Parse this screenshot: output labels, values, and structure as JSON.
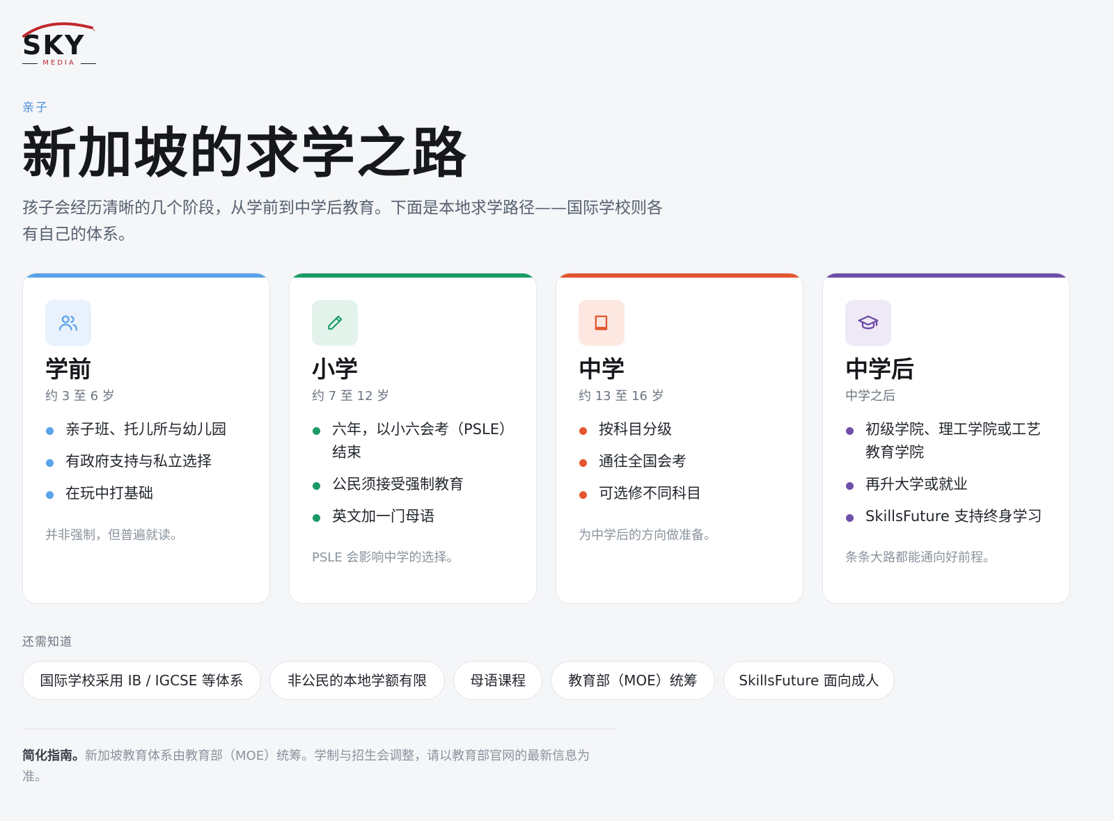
{
  "brand": {
    "name": "SKY",
    "sub": "MEDIA",
    "accent": "#c0272d"
  },
  "eyebrow": "亲子",
  "title": "新加坡的求学之路",
  "intro": "孩子会经历清晰的几个阶段，从学前到中学后教育。下面是本地求学路径——国际学校则各有自己的体系。",
  "cards": [
    {
      "icon": "people-icon",
      "color": "#5aa2e8",
      "icon_bg": "#e8f1fc",
      "title": "学前",
      "age": "约 3 至 6 岁",
      "bullets": [
        "亲子班、托儿所与幼儿园",
        "有政府支持与私立选择",
        "在玩中打基础"
      ],
      "note": "并非强制，但普遍就读。"
    },
    {
      "icon": "pencil-icon",
      "color": "#1a9a67",
      "icon_bg": "#e3f3ec",
      "title": "小学",
      "age": "约 7 至 12 岁",
      "bullets": [
        "六年，以小六会考（PSLE）结束",
        "公民须接受强制教育",
        "英文加一门母语"
      ],
      "note": "PSLE 会影响中学的选择。"
    },
    {
      "icon": "book-icon",
      "color": "#e4572e",
      "icon_bg": "#fce8e1",
      "title": "中学",
      "age": "约 13 至 16 岁",
      "bullets": [
        "按科目分级",
        "通往全国会考",
        "可选修不同科目"
      ],
      "note": "为中学后的方向做准备。"
    },
    {
      "icon": "graduation-cap-icon",
      "color": "#6f4ea8",
      "icon_bg": "#efe9f6",
      "title": "中学后",
      "age": "中学之后",
      "bullets": [
        "初级学院、理工学院或工艺教育学院",
        "再升大学或就业",
        "SkillsFuture 支持终身学习"
      ],
      "note": "条条大路都能通向好前程。"
    }
  ],
  "know": {
    "label": "还需知道",
    "chips": [
      "国际学校采用 IB / IGCSE 等体系",
      "非公民的本地学额有限",
      "母语课程",
      "教育部（MOE）统筹",
      "SkillsFuture 面向成人"
    ]
  },
  "footer": {
    "bold": "简化指南。",
    "text": "新加坡教育体系由教育部（MOE）统筹。学制与招生会调整，请以教育部官网的最新信息为准。"
  }
}
